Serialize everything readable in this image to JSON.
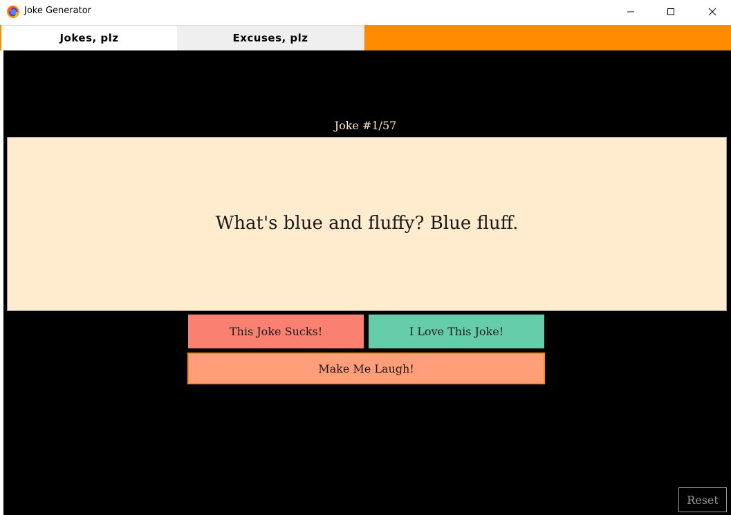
{
  "window": {
    "title": "Joke Generator",
    "app_icon": "firefox-icon",
    "controls": {
      "minimize_icon": "minimize-icon",
      "maximize_icon": "maximize-icon",
      "close_icon": "close-icon"
    }
  },
  "tabs": [
    {
      "label": "Jokes, plz",
      "active": true
    },
    {
      "label": "Excuses, plz",
      "active": false
    }
  ],
  "main": {
    "counter": "Joke #1/57",
    "joke_text": "What's blue and fluffy? Blue fluff.",
    "buttons": {
      "sucks": "This Joke Sucks!",
      "love": "I Love This Joke!",
      "laugh": "Make Me Laugh!",
      "reset": "Reset"
    }
  },
  "colors": {
    "accent": "#ff8c00",
    "joke_box": "#ffebcd",
    "sucks_button": "#fa8072",
    "love_button": "#66cdaa",
    "laugh_button": "#ff9e78",
    "background": "#000000"
  }
}
